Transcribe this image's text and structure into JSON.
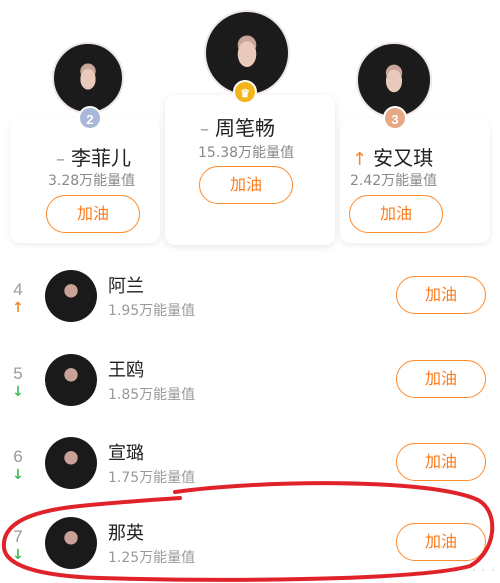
{
  "podium": {
    "first": {
      "rank_icon": "crown-icon",
      "trend_symbol": "–",
      "name": "周笔畅",
      "energy": "15.38万能量值",
      "button": "加油"
    },
    "second": {
      "rank": "2",
      "trend_symbol": "–",
      "name": "李菲儿",
      "energy": "3.28万能量值",
      "button": "加油"
    },
    "third": {
      "rank": "3",
      "trend_symbol": "↑",
      "name": "安又琪",
      "energy": "2.42万能量值",
      "button": "加油"
    }
  },
  "list": [
    {
      "rank": "4",
      "trend": "↑",
      "trend_color": "#f08a2a",
      "name": "阿兰",
      "energy": "1.95万能量值",
      "button": "加油"
    },
    {
      "rank": "5",
      "trend": "↓",
      "trend_color": "#3fbf5a",
      "name": "王鸥",
      "energy": "1.85万能量值",
      "button": "加油"
    },
    {
      "rank": "6",
      "trend": "↓",
      "trend_color": "#3fbf5a",
      "name": "宣璐",
      "energy": "1.75万能量值",
      "button": "加油"
    },
    {
      "rank": "7",
      "trend": "↓",
      "trend_color": "#3fbf5a",
      "name": "那英",
      "energy": "1.25万能量值",
      "button": "加油"
    }
  ],
  "colors": {
    "accent": "#ff7a1a",
    "badge_gold": "#f2b51b",
    "badge_silver": "#a9b8d8",
    "badge_bronze": "#e7a886",
    "annotation_red": "#e0232b"
  }
}
